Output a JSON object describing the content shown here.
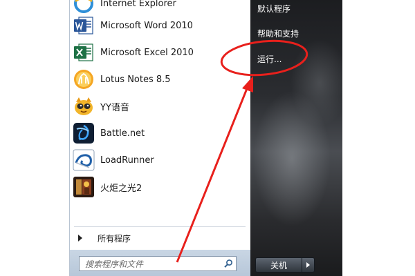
{
  "programs": [
    {
      "label": "Internet Explorer",
      "icon": "internet-explorer-icon"
    },
    {
      "label": "Microsoft Word 2010",
      "icon": "word-icon"
    },
    {
      "label": "Microsoft Excel 2010",
      "icon": "excel-icon"
    },
    {
      "label": "Lotus Notes 8.5",
      "icon": "lotus-notes-icon"
    },
    {
      "label": "YY语音",
      "icon": "yy-voice-icon"
    },
    {
      "label": "Battle.net",
      "icon": "battle-net-icon"
    },
    {
      "label": "LoadRunner",
      "icon": "loadrunner-icon"
    },
    {
      "label": "火炬之光2",
      "icon": "torchlight-icon"
    }
  ],
  "all_programs": {
    "label": "所有程序",
    "icon": "right-arrow-icon"
  },
  "search": {
    "placeholder": "搜索程序和文件",
    "icon": "search-icon"
  },
  "right_links": {
    "default_programs": "默认程序",
    "help_support": "帮助和支持",
    "run": "运行..."
  },
  "shutdown": {
    "label": "关机",
    "icon": "shutdown-options-arrow-icon"
  },
  "annotation": {
    "color": "#e8201c"
  }
}
